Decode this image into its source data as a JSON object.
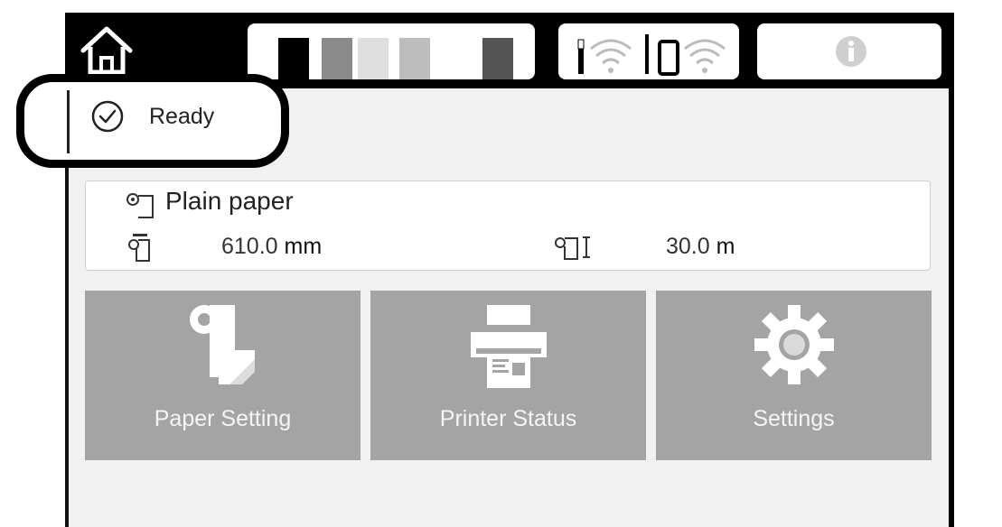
{
  "header": {
    "ink_colors": [
      "#000000",
      "#8a8a8a",
      "#dedede",
      "#bdbdbd",
      "#ffffff",
      "#555555"
    ],
    "icons": [
      "home-icon",
      "ink-levels",
      "wifi-icon",
      "wifi-direct-icon",
      "info-icon"
    ]
  },
  "status": {
    "text": "Ready",
    "icon": "check-circle-icon"
  },
  "paper": {
    "type": "Plain paper",
    "width_value": "610.0",
    "width_unit": "mm",
    "remaining_value": "30.0",
    "remaining_unit": "m"
  },
  "tiles": [
    {
      "label": "Paper Setting",
      "icon": "paper-roll-icon"
    },
    {
      "label": "Printer Status",
      "icon": "printer-icon"
    },
    {
      "label": "Settings",
      "icon": "gear-icon"
    }
  ],
  "colors": {
    "tile_bg": "#a4a4a4",
    "body_bg": "#f1f1f1",
    "frame": "#000000"
  }
}
